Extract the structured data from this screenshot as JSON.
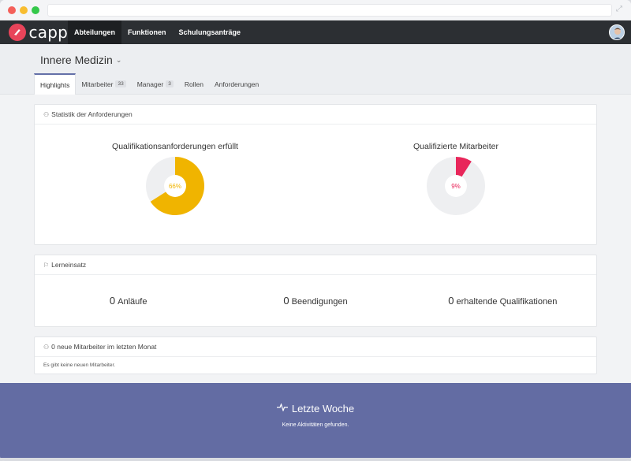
{
  "app": {
    "brand": "capp",
    "nav": [
      "Abteilungen",
      "Funktionen",
      "Schulungsanträge"
    ],
    "active_nav": 0
  },
  "department": {
    "title": "Innere Medizin",
    "tabs": [
      {
        "label": "Highlights",
        "badge": ""
      },
      {
        "label": "Mitarbeiter",
        "badge": "33"
      },
      {
        "label": "Manager",
        "badge": "3"
      },
      {
        "label": "Rollen",
        "badge": ""
      },
      {
        "label": "Anforderungen",
        "badge": ""
      }
    ],
    "active_tab": 0
  },
  "stats": {
    "header": "Statistik der Anforderungen",
    "items": [
      {
        "title": "Qualifikationsanforderungen erfüllt",
        "percent": 66,
        "label": "66%",
        "color": "#f0b400",
        "label_color": "#f0b400"
      },
      {
        "title": "Qualifizierte Mitarbeiter",
        "percent": 9,
        "label": "9%",
        "color": "#e8265a",
        "label_color": "#e8265a"
      }
    ],
    "track_color": "#eeeff1"
  },
  "learning": {
    "header": "Lerneinsatz",
    "items": [
      {
        "value": "0",
        "label": "Anläufe"
      },
      {
        "value": "0",
        "label": "Beendigungen"
      },
      {
        "value": "0",
        "label": "erhaltende Qualifikationen"
      }
    ]
  },
  "new_employees": {
    "header": "0 neue Mitarbeiter im letzten Monat",
    "empty_text": "Es gibt keine neuen Mitarbeiter."
  },
  "last_week": {
    "title": "Letzte Woche",
    "empty_text": "Keine Aktivitäten gefunden."
  },
  "colors": {
    "accent": "#636ca3",
    "navbar": "#2c2f33",
    "brand": "#e8445a"
  }
}
